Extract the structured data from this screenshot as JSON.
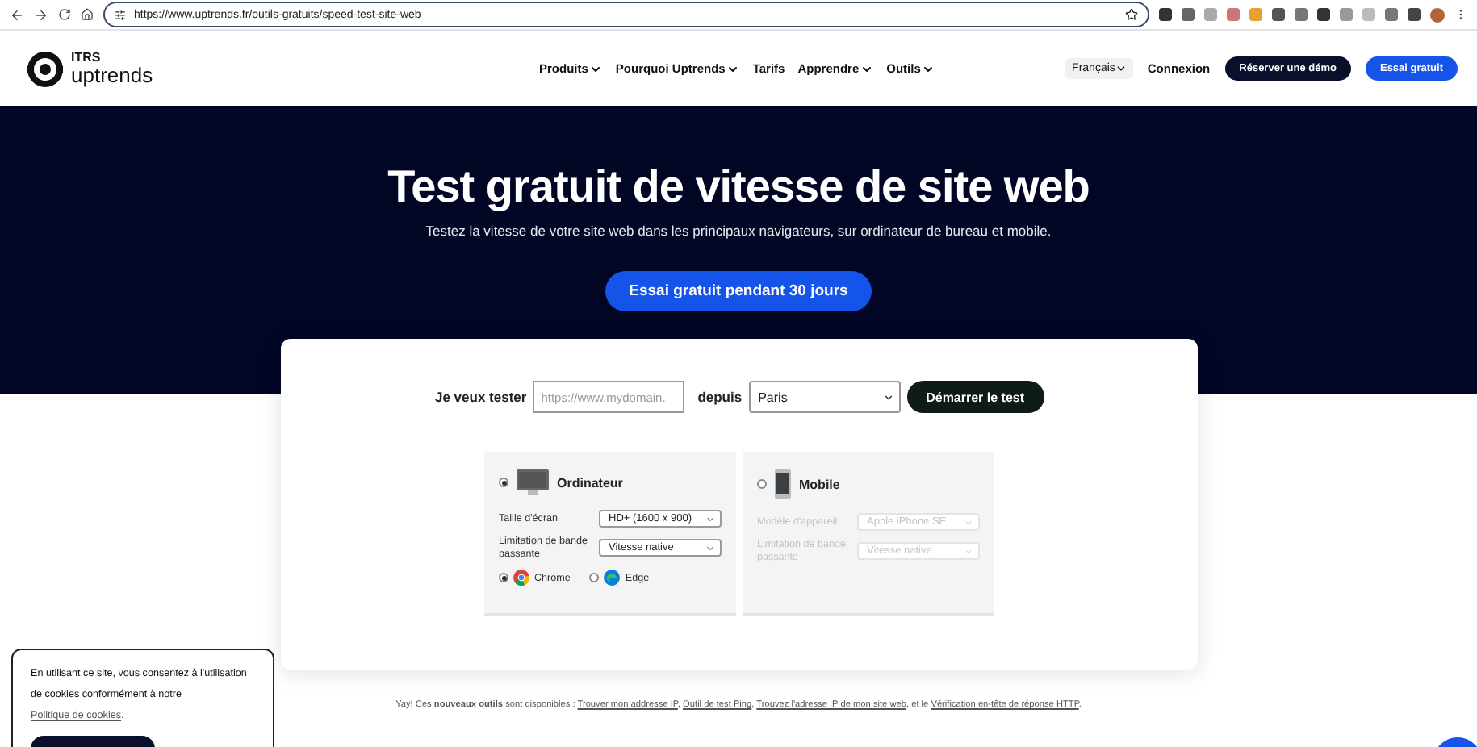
{
  "browser": {
    "url": "https://www.uptrends.fr/outils-gratuits/speed-test-site-web"
  },
  "logo": {
    "line1": "ITRS",
    "line2": "uptrends"
  },
  "nav": [
    {
      "label": "Produits",
      "dropdown": true
    },
    {
      "label": "Pourquoi Uptrends",
      "dropdown": true
    },
    {
      "label": "Tarifs",
      "dropdown": false
    },
    {
      "label": "Apprendre",
      "dropdown": true
    },
    {
      "label": "Outils",
      "dropdown": true
    }
  ],
  "language": "Français",
  "login": "Connexion",
  "demo_button": "Réserver une démo",
  "trial_button": "Essai gratuit",
  "hero": {
    "title": "Test gratuit de vitesse de site web",
    "subtitle": "Testez la vitesse de votre site web dans les principaux navigateurs, sur ordinateur de bureau et mobile.",
    "cta": "Essai gratuit pendant 30 jours"
  },
  "form": {
    "test_label": "Je veux tester",
    "url_placeholder": "https://www.mydomain.",
    "from_label": "depuis",
    "location": "Paris",
    "start_button": "Démarrer le test"
  },
  "devices": [
    {
      "kind": "desktop",
      "title": "Ordinateur",
      "selected": true,
      "fields": [
        {
          "label": "Taille d'écran",
          "value": "HD+ (1600 x 900)",
          "disabled": false
        },
        {
          "label": "Limitation de bande passante",
          "value": "Vitesse native",
          "disabled": false
        }
      ],
      "browsers": [
        {
          "name": "Chrome",
          "selected": true
        },
        {
          "name": "Edge",
          "selected": false
        }
      ]
    },
    {
      "kind": "mobile",
      "title": "Mobile",
      "selected": false,
      "fields": [
        {
          "label": "Modèle d'appareil",
          "value": "Apple iPhone SE",
          "disabled": true
        },
        {
          "label": "Limitation de bande passante",
          "value": "Vitesse native",
          "disabled": true
        }
      ]
    }
  ],
  "footer_note": [
    {
      "kind": "text",
      "text": "Yay! Ces **nouveaux outils** sont disponibles : "
    },
    {
      "kind": "link",
      "text": "Trouver mon addresse IP"
    },
    {
      "kind": "text",
      "text": ", "
    },
    {
      "kind": "link",
      "text": "Outil de test Ping"
    },
    {
      "kind": "text",
      "text": ", "
    },
    {
      "kind": "link",
      "text": "Trouvez l'adresse IP de mon site web"
    },
    {
      "kind": "text",
      "text": ", et le "
    },
    {
      "kind": "link",
      "text": "Vérification en-tête de réponse HTTP"
    },
    {
      "kind": "text",
      "text": "."
    }
  ],
  "cookie_notice": [
    {
      "kind": "text",
      "text": "En utilisant ce site, vous consentez à l'utilisation de cookies conformément à notre "
    },
    {
      "kind": "link",
      "text": "Politique de cookies"
    },
    {
      "kind": "text",
      "text": "."
    }
  ]
}
